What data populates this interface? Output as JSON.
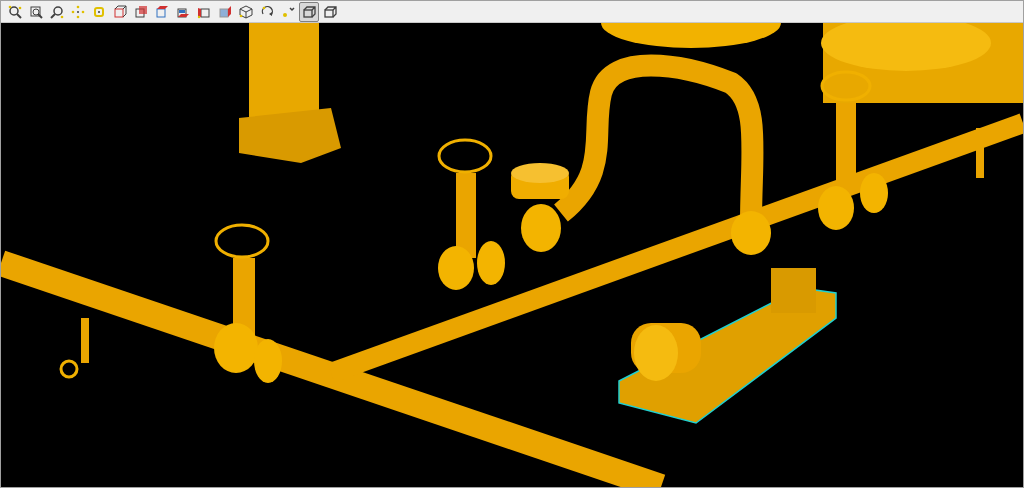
{
  "toolbar": {
    "buttons": [
      {
        "kind": "zoom-window",
        "selected": false
      },
      {
        "kind": "zoom-box",
        "selected": false
      },
      {
        "kind": "zoom",
        "selected": false
      },
      {
        "kind": "pan",
        "selected": false
      },
      {
        "kind": "center",
        "selected": false
      },
      {
        "kind": "view-front",
        "selected": false
      },
      {
        "kind": "view-back",
        "selected": false
      },
      {
        "kind": "view-top",
        "selected": false
      },
      {
        "kind": "view-bottom",
        "selected": false
      },
      {
        "kind": "view-left",
        "selected": false
      },
      {
        "kind": "view-right",
        "selected": false
      },
      {
        "kind": "view-iso",
        "selected": false
      },
      {
        "kind": "rotate",
        "selected": false
      },
      {
        "kind": "point",
        "selected": false
      },
      {
        "kind": "shaded",
        "selected": true
      },
      {
        "kind": "wireframe",
        "selected": false
      }
    ]
  }
}
